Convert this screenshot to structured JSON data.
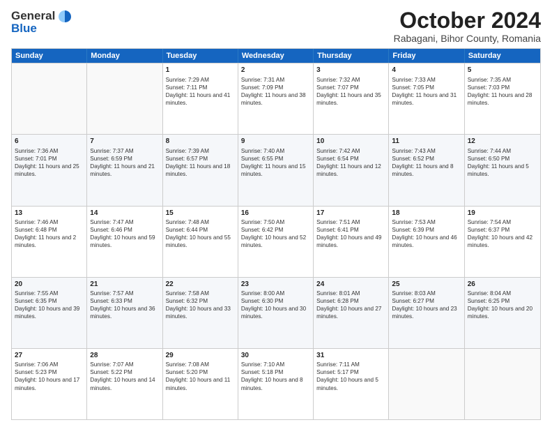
{
  "logo": {
    "general": "General",
    "blue": "Blue"
  },
  "title": "October 2024",
  "location": "Rabagani, Bihor County, Romania",
  "header_days": [
    "Sunday",
    "Monday",
    "Tuesday",
    "Wednesday",
    "Thursday",
    "Friday",
    "Saturday"
  ],
  "weeks": [
    [
      {
        "day": "",
        "sunrise": "",
        "sunset": "",
        "daylight": "",
        "empty": true
      },
      {
        "day": "",
        "sunrise": "",
        "sunset": "",
        "daylight": "",
        "empty": true
      },
      {
        "day": "1",
        "sunrise": "Sunrise: 7:29 AM",
        "sunset": "Sunset: 7:11 PM",
        "daylight": "Daylight: 11 hours and 41 minutes."
      },
      {
        "day": "2",
        "sunrise": "Sunrise: 7:31 AM",
        "sunset": "Sunset: 7:09 PM",
        "daylight": "Daylight: 11 hours and 38 minutes."
      },
      {
        "day": "3",
        "sunrise": "Sunrise: 7:32 AM",
        "sunset": "Sunset: 7:07 PM",
        "daylight": "Daylight: 11 hours and 35 minutes."
      },
      {
        "day": "4",
        "sunrise": "Sunrise: 7:33 AM",
        "sunset": "Sunset: 7:05 PM",
        "daylight": "Daylight: 11 hours and 31 minutes."
      },
      {
        "day": "5",
        "sunrise": "Sunrise: 7:35 AM",
        "sunset": "Sunset: 7:03 PM",
        "daylight": "Daylight: 11 hours and 28 minutes."
      }
    ],
    [
      {
        "day": "6",
        "sunrise": "Sunrise: 7:36 AM",
        "sunset": "Sunset: 7:01 PM",
        "daylight": "Daylight: 11 hours and 25 minutes."
      },
      {
        "day": "7",
        "sunrise": "Sunrise: 7:37 AM",
        "sunset": "Sunset: 6:59 PM",
        "daylight": "Daylight: 11 hours and 21 minutes."
      },
      {
        "day": "8",
        "sunrise": "Sunrise: 7:39 AM",
        "sunset": "Sunset: 6:57 PM",
        "daylight": "Daylight: 11 hours and 18 minutes."
      },
      {
        "day": "9",
        "sunrise": "Sunrise: 7:40 AM",
        "sunset": "Sunset: 6:55 PM",
        "daylight": "Daylight: 11 hours and 15 minutes."
      },
      {
        "day": "10",
        "sunrise": "Sunrise: 7:42 AM",
        "sunset": "Sunset: 6:54 PM",
        "daylight": "Daylight: 11 hours and 12 minutes."
      },
      {
        "day": "11",
        "sunrise": "Sunrise: 7:43 AM",
        "sunset": "Sunset: 6:52 PM",
        "daylight": "Daylight: 11 hours and 8 minutes."
      },
      {
        "day": "12",
        "sunrise": "Sunrise: 7:44 AM",
        "sunset": "Sunset: 6:50 PM",
        "daylight": "Daylight: 11 hours and 5 minutes."
      }
    ],
    [
      {
        "day": "13",
        "sunrise": "Sunrise: 7:46 AM",
        "sunset": "Sunset: 6:48 PM",
        "daylight": "Daylight: 11 hours and 2 minutes."
      },
      {
        "day": "14",
        "sunrise": "Sunrise: 7:47 AM",
        "sunset": "Sunset: 6:46 PM",
        "daylight": "Daylight: 10 hours and 59 minutes."
      },
      {
        "day": "15",
        "sunrise": "Sunrise: 7:48 AM",
        "sunset": "Sunset: 6:44 PM",
        "daylight": "Daylight: 10 hours and 55 minutes."
      },
      {
        "day": "16",
        "sunrise": "Sunrise: 7:50 AM",
        "sunset": "Sunset: 6:42 PM",
        "daylight": "Daylight: 10 hours and 52 minutes."
      },
      {
        "day": "17",
        "sunrise": "Sunrise: 7:51 AM",
        "sunset": "Sunset: 6:41 PM",
        "daylight": "Daylight: 10 hours and 49 minutes."
      },
      {
        "day": "18",
        "sunrise": "Sunrise: 7:53 AM",
        "sunset": "Sunset: 6:39 PM",
        "daylight": "Daylight: 10 hours and 46 minutes."
      },
      {
        "day": "19",
        "sunrise": "Sunrise: 7:54 AM",
        "sunset": "Sunset: 6:37 PM",
        "daylight": "Daylight: 10 hours and 42 minutes."
      }
    ],
    [
      {
        "day": "20",
        "sunrise": "Sunrise: 7:55 AM",
        "sunset": "Sunset: 6:35 PM",
        "daylight": "Daylight: 10 hours and 39 minutes."
      },
      {
        "day": "21",
        "sunrise": "Sunrise: 7:57 AM",
        "sunset": "Sunset: 6:33 PM",
        "daylight": "Daylight: 10 hours and 36 minutes."
      },
      {
        "day": "22",
        "sunrise": "Sunrise: 7:58 AM",
        "sunset": "Sunset: 6:32 PM",
        "daylight": "Daylight: 10 hours and 33 minutes."
      },
      {
        "day": "23",
        "sunrise": "Sunrise: 8:00 AM",
        "sunset": "Sunset: 6:30 PM",
        "daylight": "Daylight: 10 hours and 30 minutes."
      },
      {
        "day": "24",
        "sunrise": "Sunrise: 8:01 AM",
        "sunset": "Sunset: 6:28 PM",
        "daylight": "Daylight: 10 hours and 27 minutes."
      },
      {
        "day": "25",
        "sunrise": "Sunrise: 8:03 AM",
        "sunset": "Sunset: 6:27 PM",
        "daylight": "Daylight: 10 hours and 23 minutes."
      },
      {
        "day": "26",
        "sunrise": "Sunrise: 8:04 AM",
        "sunset": "Sunset: 6:25 PM",
        "daylight": "Daylight: 10 hours and 20 minutes."
      }
    ],
    [
      {
        "day": "27",
        "sunrise": "Sunrise: 7:06 AM",
        "sunset": "Sunset: 5:23 PM",
        "daylight": "Daylight: 10 hours and 17 minutes."
      },
      {
        "day": "28",
        "sunrise": "Sunrise: 7:07 AM",
        "sunset": "Sunset: 5:22 PM",
        "daylight": "Daylight: 10 hours and 14 minutes."
      },
      {
        "day": "29",
        "sunrise": "Sunrise: 7:08 AM",
        "sunset": "Sunset: 5:20 PM",
        "daylight": "Daylight: 10 hours and 11 minutes."
      },
      {
        "day": "30",
        "sunrise": "Sunrise: 7:10 AM",
        "sunset": "Sunset: 5:18 PM",
        "daylight": "Daylight: 10 hours and 8 minutes."
      },
      {
        "day": "31",
        "sunrise": "Sunrise: 7:11 AM",
        "sunset": "Sunset: 5:17 PM",
        "daylight": "Daylight: 10 hours and 5 minutes."
      },
      {
        "day": "",
        "sunrise": "",
        "sunset": "",
        "daylight": "",
        "empty": true
      },
      {
        "day": "",
        "sunrise": "",
        "sunset": "",
        "daylight": "",
        "empty": true
      }
    ]
  ]
}
